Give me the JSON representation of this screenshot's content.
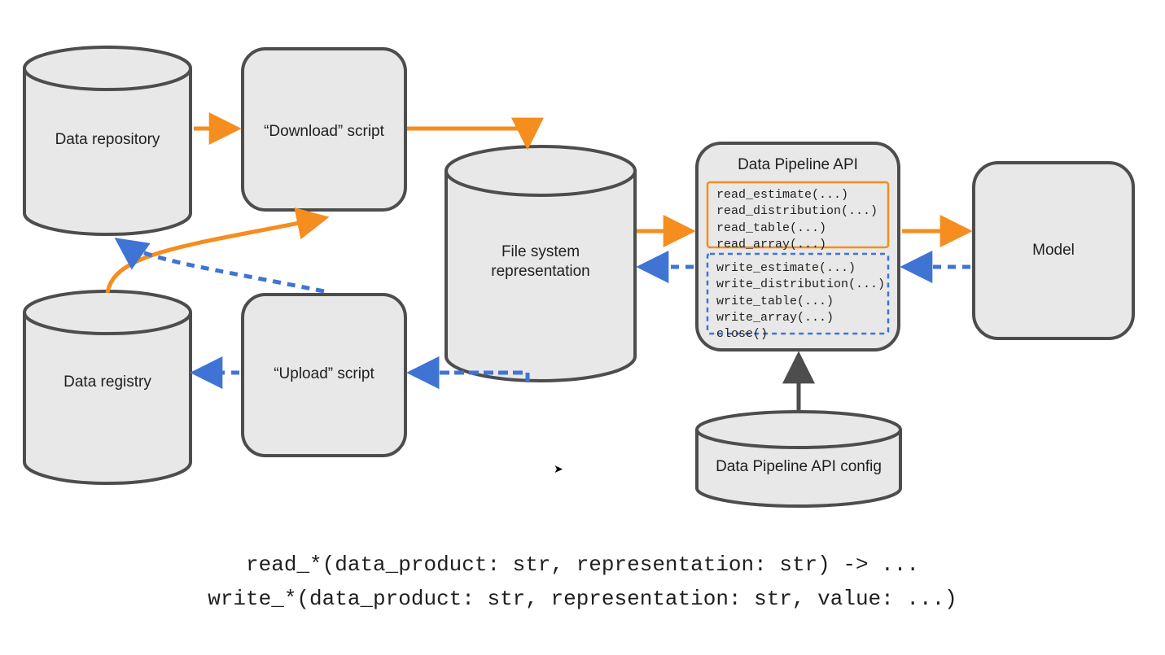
{
  "nodes": {
    "data_repository": "Data repository",
    "download_script": "“Download” script",
    "data_registry": "Data registry",
    "upload_script": "“Upload” script",
    "file_system": "File system\nrepresentation",
    "api_title": "Data Pipeline API",
    "api_config": "Data Pipeline API config",
    "model": "Model"
  },
  "api_read": "read_estimate(...)\nread_distribution(...)\nread_table(...)\nread_array(...)",
  "api_write": "write_estimate(...)\nwrite_distribution(...)\nwrite_table(...)\nwrite_array(...)\nclose()",
  "signatures": {
    "read": "read_*(data_product: str, representation: str) -> ...",
    "write": "write_*(data_product: str, representation: str, value: ...)"
  },
  "colors": {
    "node_fill": "#e8e8e8",
    "node_stroke": "#4d4d4d",
    "orange": "#f58d1f",
    "blue": "#3f74d4"
  }
}
